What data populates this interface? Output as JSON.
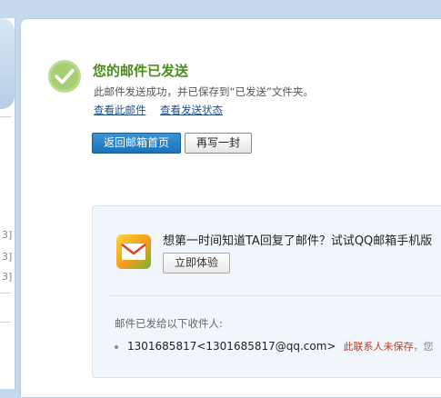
{
  "left_panel": {
    "brackets": [
      "3]",
      "3]",
      "3]"
    ]
  },
  "result": {
    "title": "您的邮件已发送",
    "description": "此邮件发送成功，并已保存到“已发送”文件夹。",
    "view_mail_link": "查看此邮件",
    "view_status_link": "查看发送状态"
  },
  "buttons": {
    "back_home": "返回邮箱首页",
    "write_again": "再写一封"
  },
  "promo": {
    "text": "想第一时间知道TA回复了邮件？试试QQ邮箱手机版",
    "try_button": "立即体验"
  },
  "recipients": {
    "label": "邮件已发给以下收件人:",
    "items": [
      {
        "address": "1301685817<1301685817@qq.com>",
        "warning": "此联系人未保存",
        "tail": "，您"
      }
    ]
  },
  "colors": {
    "title_green": "#4a8e1a",
    "button_blue": "#1c72b9",
    "warning_red": "#c03a1e",
    "link_blue": "#1d4f91"
  }
}
